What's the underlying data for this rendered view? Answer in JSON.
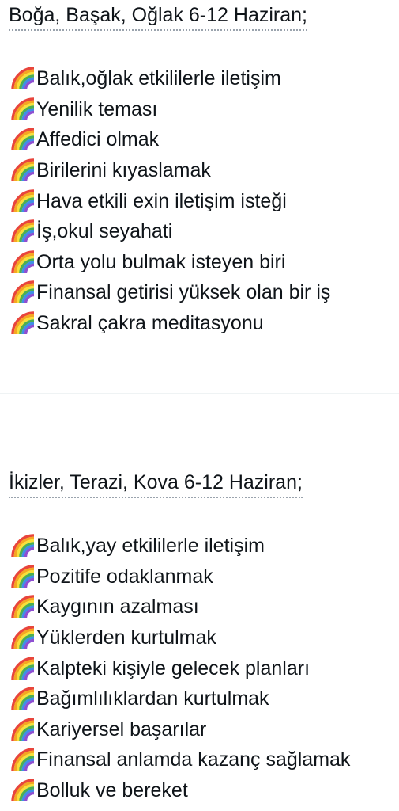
{
  "sections": [
    {
      "heading": "Boğa, Başak, Oğlak 6-12 Haziran;",
      "items": [
        {
          "icon": "rainbow-icon",
          "text": "Balık,oğlak etkililerle iletişim"
        },
        {
          "icon": "rainbow-icon",
          "text": "Yenilik teması"
        },
        {
          "icon": "rainbow-icon",
          "text": "Affedici olmak"
        },
        {
          "icon": "rainbow-icon",
          "text": "Birilerini kıyaslamak"
        },
        {
          "icon": "rainbow-icon",
          "text": "Hava etkili exin iletişim isteği"
        },
        {
          "icon": "rainbow-icon",
          "text": "İş,okul seyahati"
        },
        {
          "icon": "rainbow-icon",
          "text": "Orta yolu bulmak isteyen biri"
        },
        {
          "icon": "rainbow-icon",
          "text": "Finansal getirisi yüksek olan bir iş"
        },
        {
          "icon": "rainbow-icon",
          "text": "Sakral çakra meditasyonu"
        }
      ]
    },
    {
      "heading": "İkizler, Terazi, Kova 6-12 Haziran;",
      "items": [
        {
          "icon": "rainbow-icon",
          "text": "Balık,yay etkililerle iletişim"
        },
        {
          "icon": "rainbow-icon",
          "text": "Pozitife odaklanmak"
        },
        {
          "icon": "rainbow-icon",
          "text": "Kaygının azalması"
        },
        {
          "icon": "rainbow-icon",
          "text": "Yüklerden kurtulmak"
        },
        {
          "icon": "rainbow-icon",
          "text": "Kalpteki kişiyle gelecek planları"
        },
        {
          "icon": "rainbow-icon",
          "text": "Bağımlılıklardan kurtulmak"
        },
        {
          "icon": "rainbow-icon",
          "text": "Kariyersel başarılar"
        },
        {
          "icon": "rainbow-icon",
          "text": "Finansal anlamda kazanç sağlamak"
        },
        {
          "icon": "rainbow-icon",
          "text": "Bolluk ve bereket"
        }
      ]
    }
  ]
}
